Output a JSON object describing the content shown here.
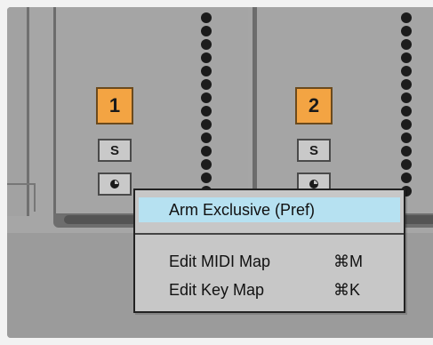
{
  "tracks": [
    {
      "number": "1",
      "solo_label": "S",
      "arm_icon": "record-arm-icon",
      "color": "#f3a443"
    },
    {
      "number": "2",
      "solo_label": "S",
      "arm_icon": "record-arm-icon",
      "color": "#f3a443"
    }
  ],
  "context_menu": {
    "items": [
      {
        "label": "Arm Exclusive (Pref)",
        "shortcut": "",
        "highlighted": true
      },
      {
        "label": "Edit MIDI Map",
        "shortcut": "⌘M",
        "highlighted": false
      },
      {
        "label": "Edit Key Map",
        "shortcut": "⌘K",
        "highlighted": false
      }
    ],
    "highlight_color": "#b6e1f1"
  }
}
